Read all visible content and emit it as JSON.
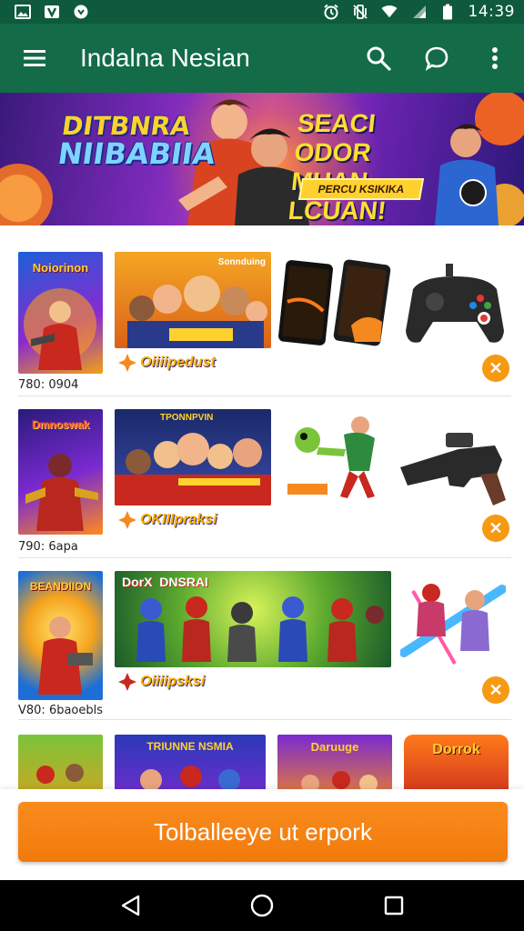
{
  "status_bar": {
    "time": "14:39",
    "left_icons": [
      "gallery-icon",
      "app-notification-icon",
      "chat-notification-icon"
    ],
    "right_icons": [
      "alarm-icon",
      "vibrate-icon",
      "wifi-icon",
      "signal-icon",
      "battery-icon"
    ]
  },
  "app_bar": {
    "title": "Indalna Nesian",
    "menu_icon": "hamburger-menu-icon",
    "actions": [
      "search-icon",
      "chat-icon",
      "more-vert-icon"
    ]
  },
  "banner": {
    "title_line1": "DITBNRA",
    "title_line2": "NIIBABIIA",
    "right_text_line1": "SEACI ODOR",
    "right_text_line2": "MUAN LCUAN!",
    "badge": "PERCU KSIKIKA"
  },
  "rows": [
    {
      "caption": "780: 0904",
      "promo": "Oiiiipedust",
      "cover_title": "Noiorinon",
      "wide_title": "Sonnduing",
      "items": [
        "two-smartphones",
        "game-controller"
      ]
    },
    {
      "caption": "790: 6apa",
      "promo": "OKIIIpraksi",
      "cover_title": "Dmnoswak",
      "wide_title": "TPONNPVIN",
      "items": [
        "cartoon-fighter-figure",
        "toy-blaster"
      ]
    },
    {
      "caption": "V80: 6baoebls",
      "promo": "Oiiiipsksi",
      "cover_title": "BEANDIION",
      "wide_title": "DorX  DNSRAI",
      "items": [
        "heroes-artwork"
      ]
    },
    {
      "caption": "",
      "promo": "",
      "cover_title": "",
      "wide_title": "TRIUNNE NSMIA",
      "items": [
        "Daruuge",
        "Dorrok"
      ]
    }
  ],
  "cta": {
    "label": "Tolballeeye ut erpork"
  },
  "nav_bar": {
    "buttons": [
      "back-icon",
      "home-icon",
      "recents-icon"
    ]
  },
  "colors": {
    "status_bar": "#0f5a3c",
    "app_bar": "#136b48",
    "accent_orange": "#f5890f",
    "close_badge": "#f59a12"
  }
}
